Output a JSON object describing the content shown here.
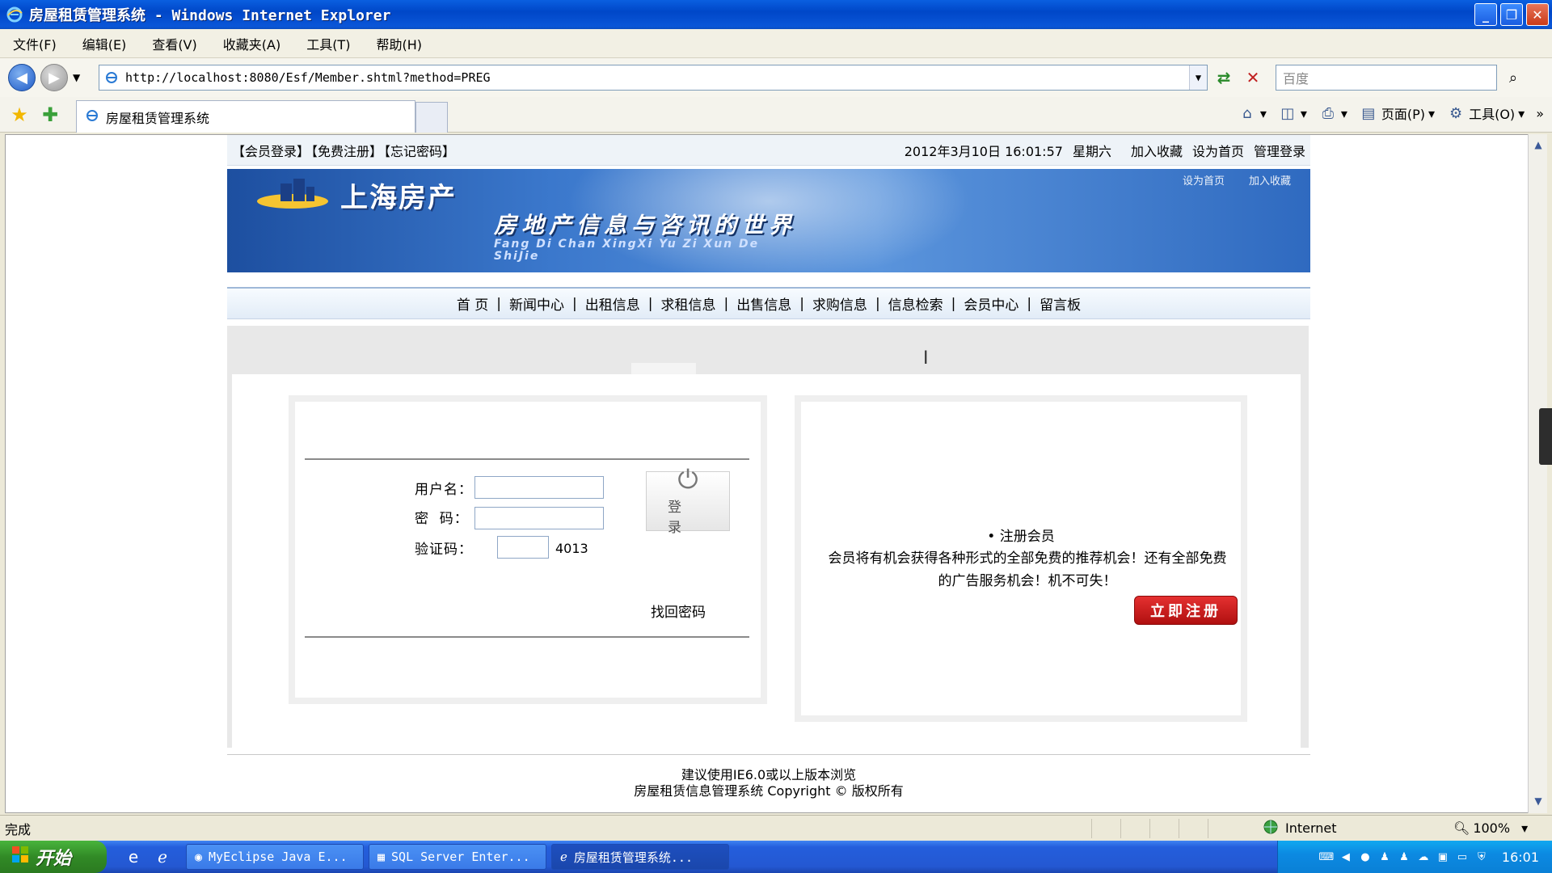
{
  "window": {
    "title": "房屋租赁管理系统 - Windows Internet Explorer",
    "controls": [
      "_",
      "❐",
      "✕"
    ]
  },
  "menu": [
    "文件(F)",
    "编辑(E)",
    "查看(V)",
    "收藏夹(A)",
    "工具(T)",
    "帮助(H)"
  ],
  "address": {
    "url": "http://localhost:8080/Esf/Member.shtml?method=PREG",
    "search_placeholder": "百度"
  },
  "tab": {
    "title": "房屋租赁管理系统"
  },
  "command_bar": {
    "page_label": "页面(P)",
    "tools_label": "工具(O)"
  },
  "page": {
    "top_links": [
      "【会员登录】",
      "【免费注册】",
      "【忘记密码】"
    ],
    "datetime": "2012年3月10日 16:01:57",
    "weekday": "星期六",
    "top_right_links": [
      "加入收藏",
      "设为首页",
      "管理登录"
    ],
    "banner": {
      "logo_text": "上海房产",
      "slogan": "房地产信息与咨讯的世界",
      "slogan_pinyin": "Fang Di Chan XingXi Yu Zi Xun De ShiJie",
      "top_right": [
        "设为首页",
        "加入收藏"
      ]
    },
    "nav": [
      "首 页",
      "新闻中心",
      "出租信息",
      "求租信息",
      "出售信息",
      "求购信息",
      "信息检索",
      "会员中心",
      "留言板"
    ],
    "login": {
      "username_label": "用户名：",
      "password_label": "密  码：",
      "captcha_label": "验证码：",
      "username_value": "",
      "password_value": "",
      "captcha_value": "",
      "captcha_code": "4013",
      "submit_label": "登录",
      "recover_label": "找回密码"
    },
    "register": {
      "title": "• 注册会员",
      "desc": "会员将有机会获得各种形式的全部免费的推荐机会！还有全部免费的广告服务机会！机不可失！",
      "button": "立即注册"
    },
    "footer": {
      "line1": "建议使用IE6.0或以上版本浏览",
      "line2": "房屋租赁信息管理系统 Copyright © 版权所有"
    }
  },
  "status": {
    "text": "完成",
    "zone": "Internet",
    "zoom": "100%"
  },
  "taskbar": {
    "start": "开始",
    "buttons": [
      "MyEclipse Java E...",
      "SQL Server Enter...",
      "房屋租赁管理系统..."
    ],
    "clock": "16:01"
  }
}
